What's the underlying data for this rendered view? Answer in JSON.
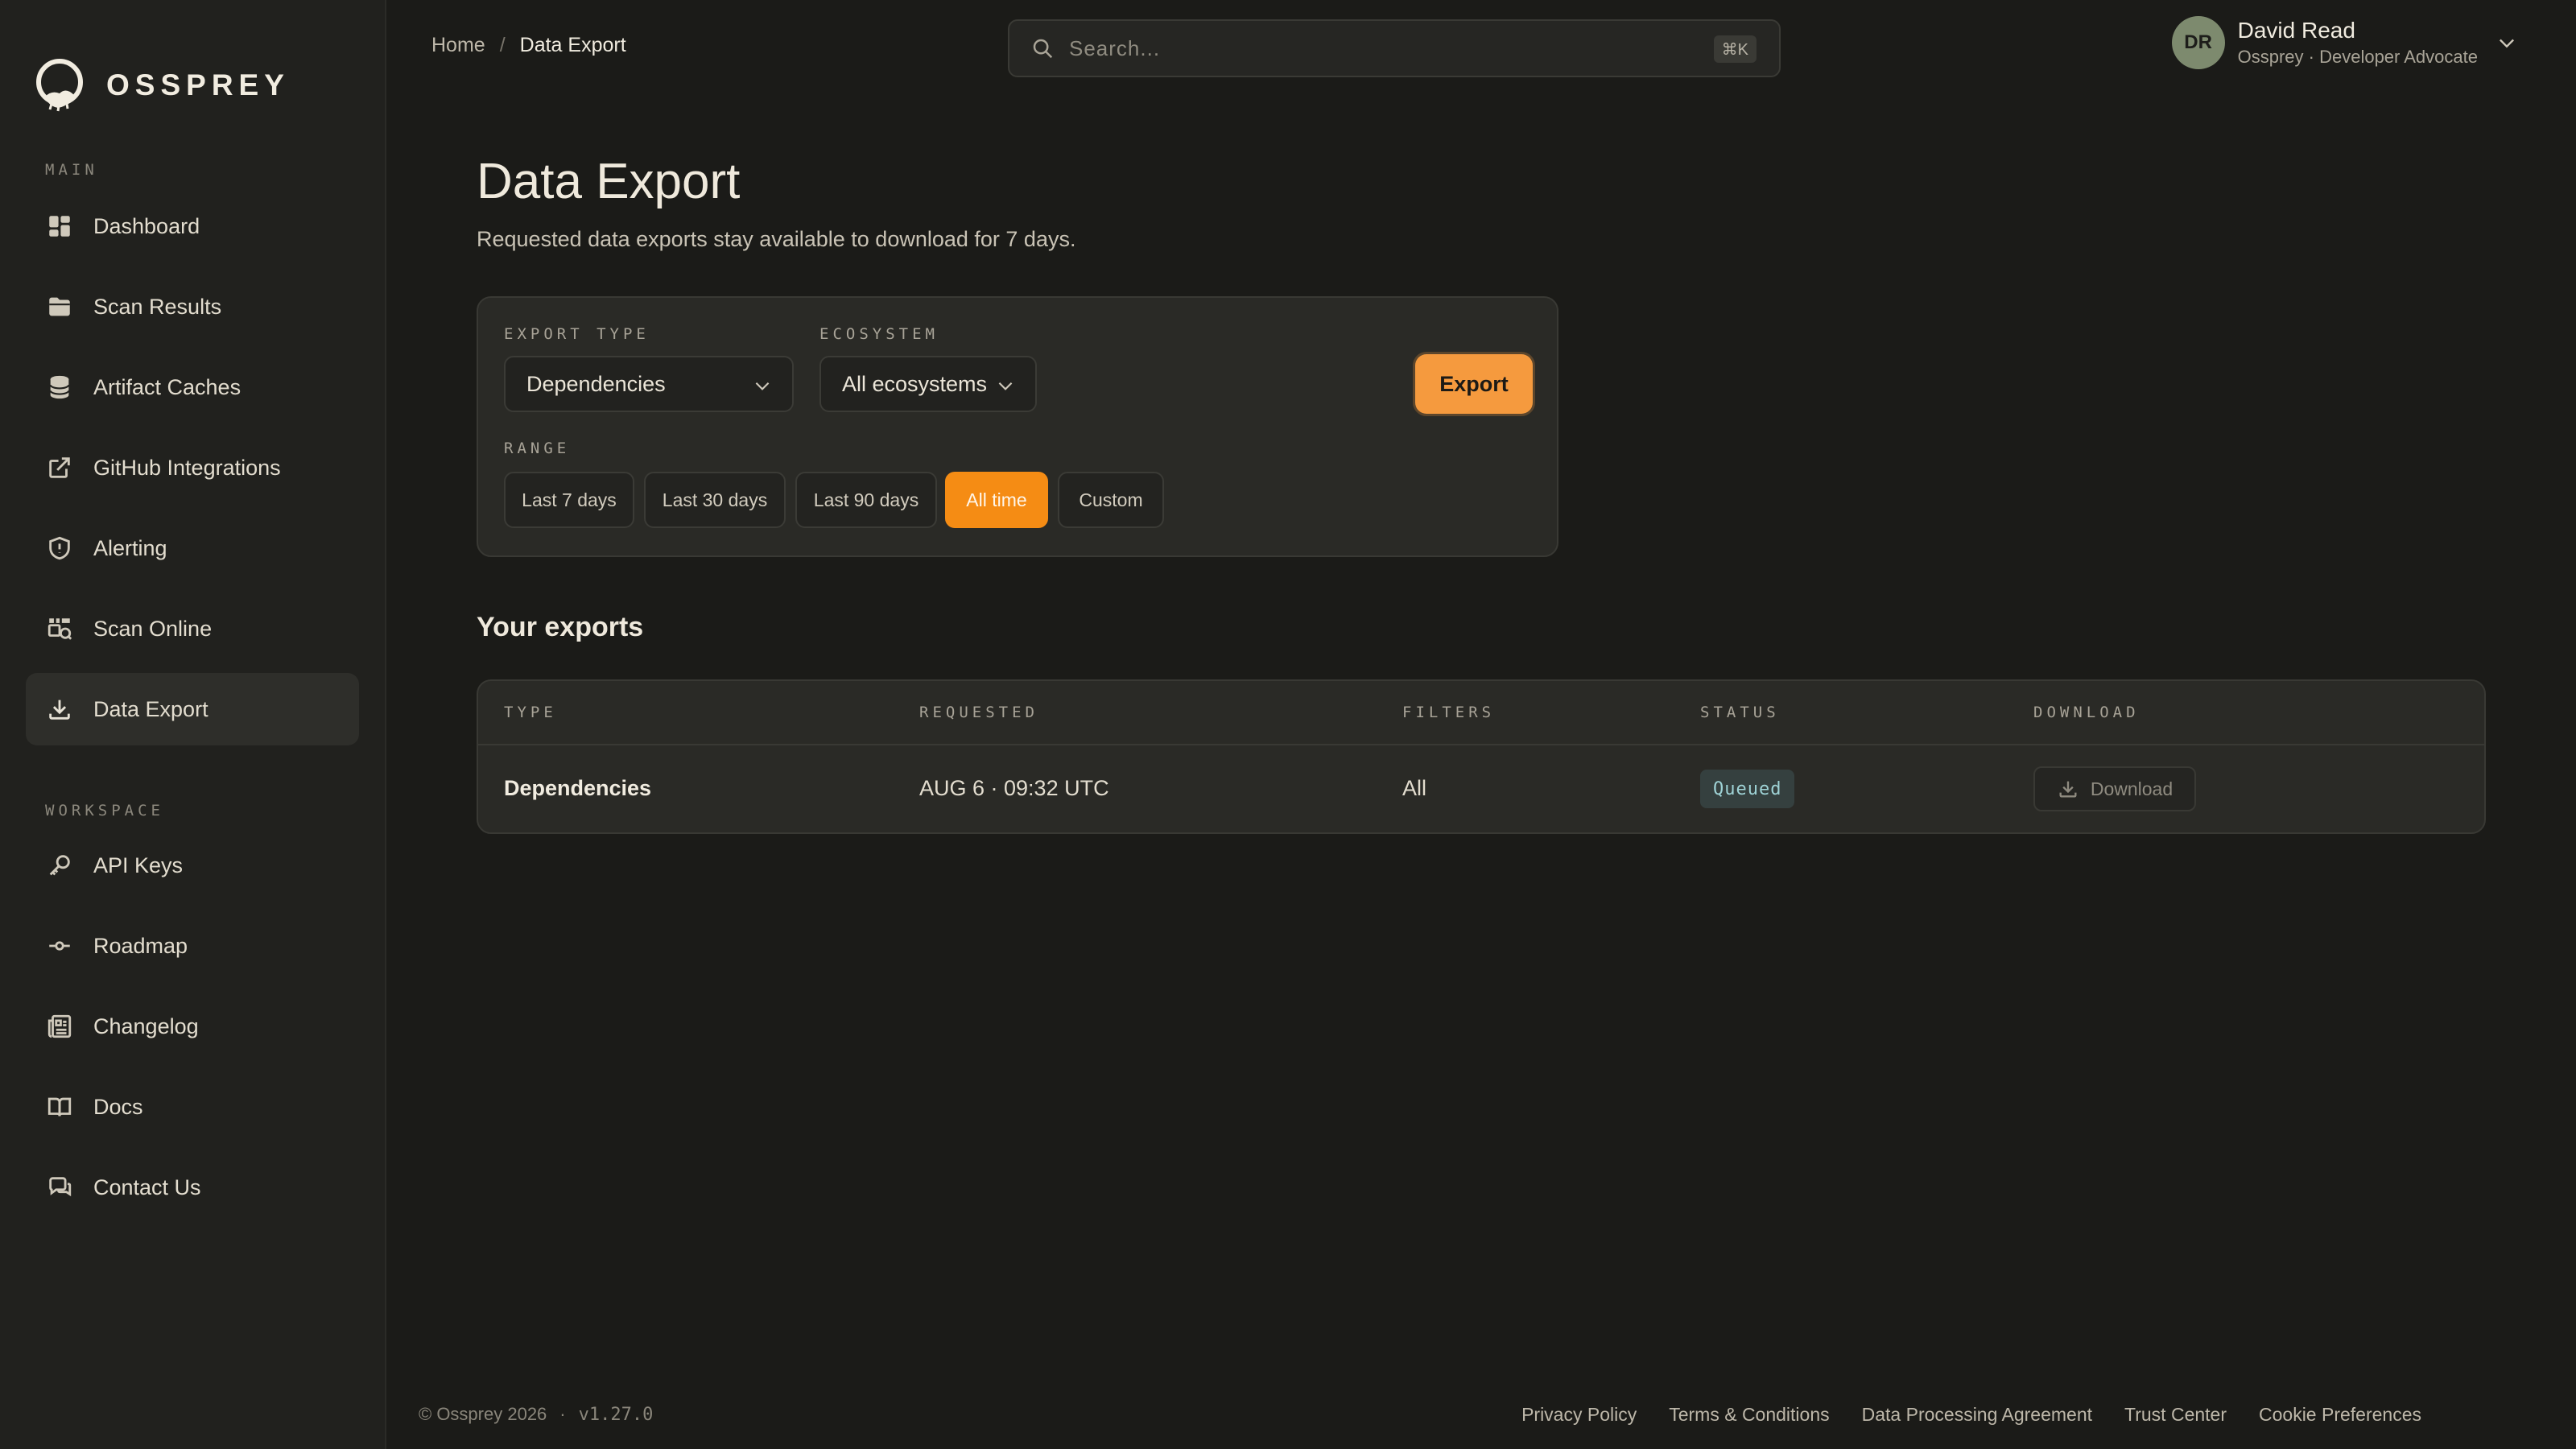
{
  "brand": {
    "name": "OSSPREY"
  },
  "sidebar": {
    "main_section": "MAIN",
    "workspace_section": "WORKSPACE",
    "items": [
      {
        "label": "Dashboard",
        "icon": "dashboard-icon"
      },
      {
        "label": "Scan Results",
        "icon": "folder-icon"
      },
      {
        "label": "Artifact Caches",
        "icon": "database-icon"
      },
      {
        "label": "GitHub Integrations",
        "icon": "external-link-icon"
      },
      {
        "label": "Alerting",
        "icon": "shield-icon"
      },
      {
        "label": "Scan Online",
        "icon": "scan-icon"
      },
      {
        "label": "Data Export",
        "icon": "download-icon",
        "active": true
      }
    ],
    "workspace_items": [
      {
        "label": "API Keys",
        "icon": "key-icon"
      },
      {
        "label": "Roadmap",
        "icon": "roadmap-icon"
      },
      {
        "label": "Changelog",
        "icon": "changelog-icon"
      },
      {
        "label": "Docs",
        "icon": "book-icon"
      },
      {
        "label": "Contact Us",
        "icon": "chat-icon"
      }
    ]
  },
  "breadcrumb": {
    "home": "Home",
    "separator": "/",
    "current": "Data Export"
  },
  "search": {
    "placeholder": "Search...",
    "shortcut": "⌘K"
  },
  "user": {
    "initials": "DR",
    "name": "David Read",
    "role": "Ossprey · Developer Advocate"
  },
  "page": {
    "title": "Data Export",
    "subtitle": "Requested data exports stay available to download for 7 days."
  },
  "export_form": {
    "export_type_label": "EXPORT TYPE",
    "export_type_value": "Dependencies",
    "ecosystem_label": "ECOSYSTEM",
    "ecosystem_value": "All ecosystems",
    "export_button": "Export",
    "range_label": "RANGE",
    "ranges": [
      "Last 7 days",
      "Last 30 days",
      "Last 90 days",
      "All time",
      "Custom"
    ],
    "selected_range": "All time"
  },
  "exports": {
    "title": "Your exports",
    "columns": [
      "TYPE",
      "REQUESTED",
      "FILTERS",
      "STATUS",
      "DOWNLOAD"
    ],
    "rows": [
      {
        "type": "Dependencies",
        "requested": "AUG 6 · 09:32 UTC",
        "filters": "All",
        "status": "Queued",
        "download": "Download"
      }
    ]
  },
  "footer": {
    "copyright": "© Ossprey 2026",
    "dot": "·",
    "version": "v1.27.0",
    "links": [
      "Privacy Policy",
      "Terms & Conditions",
      "Data Processing Agreement",
      "Trust Center",
      "Cookie Preferences"
    ]
  },
  "colors": {
    "background": "#1b1b18",
    "sidebar": "#21211e",
    "accent": "#f59a3e",
    "active_range": "#f58c14",
    "status_queued": "#9fd3d6"
  }
}
